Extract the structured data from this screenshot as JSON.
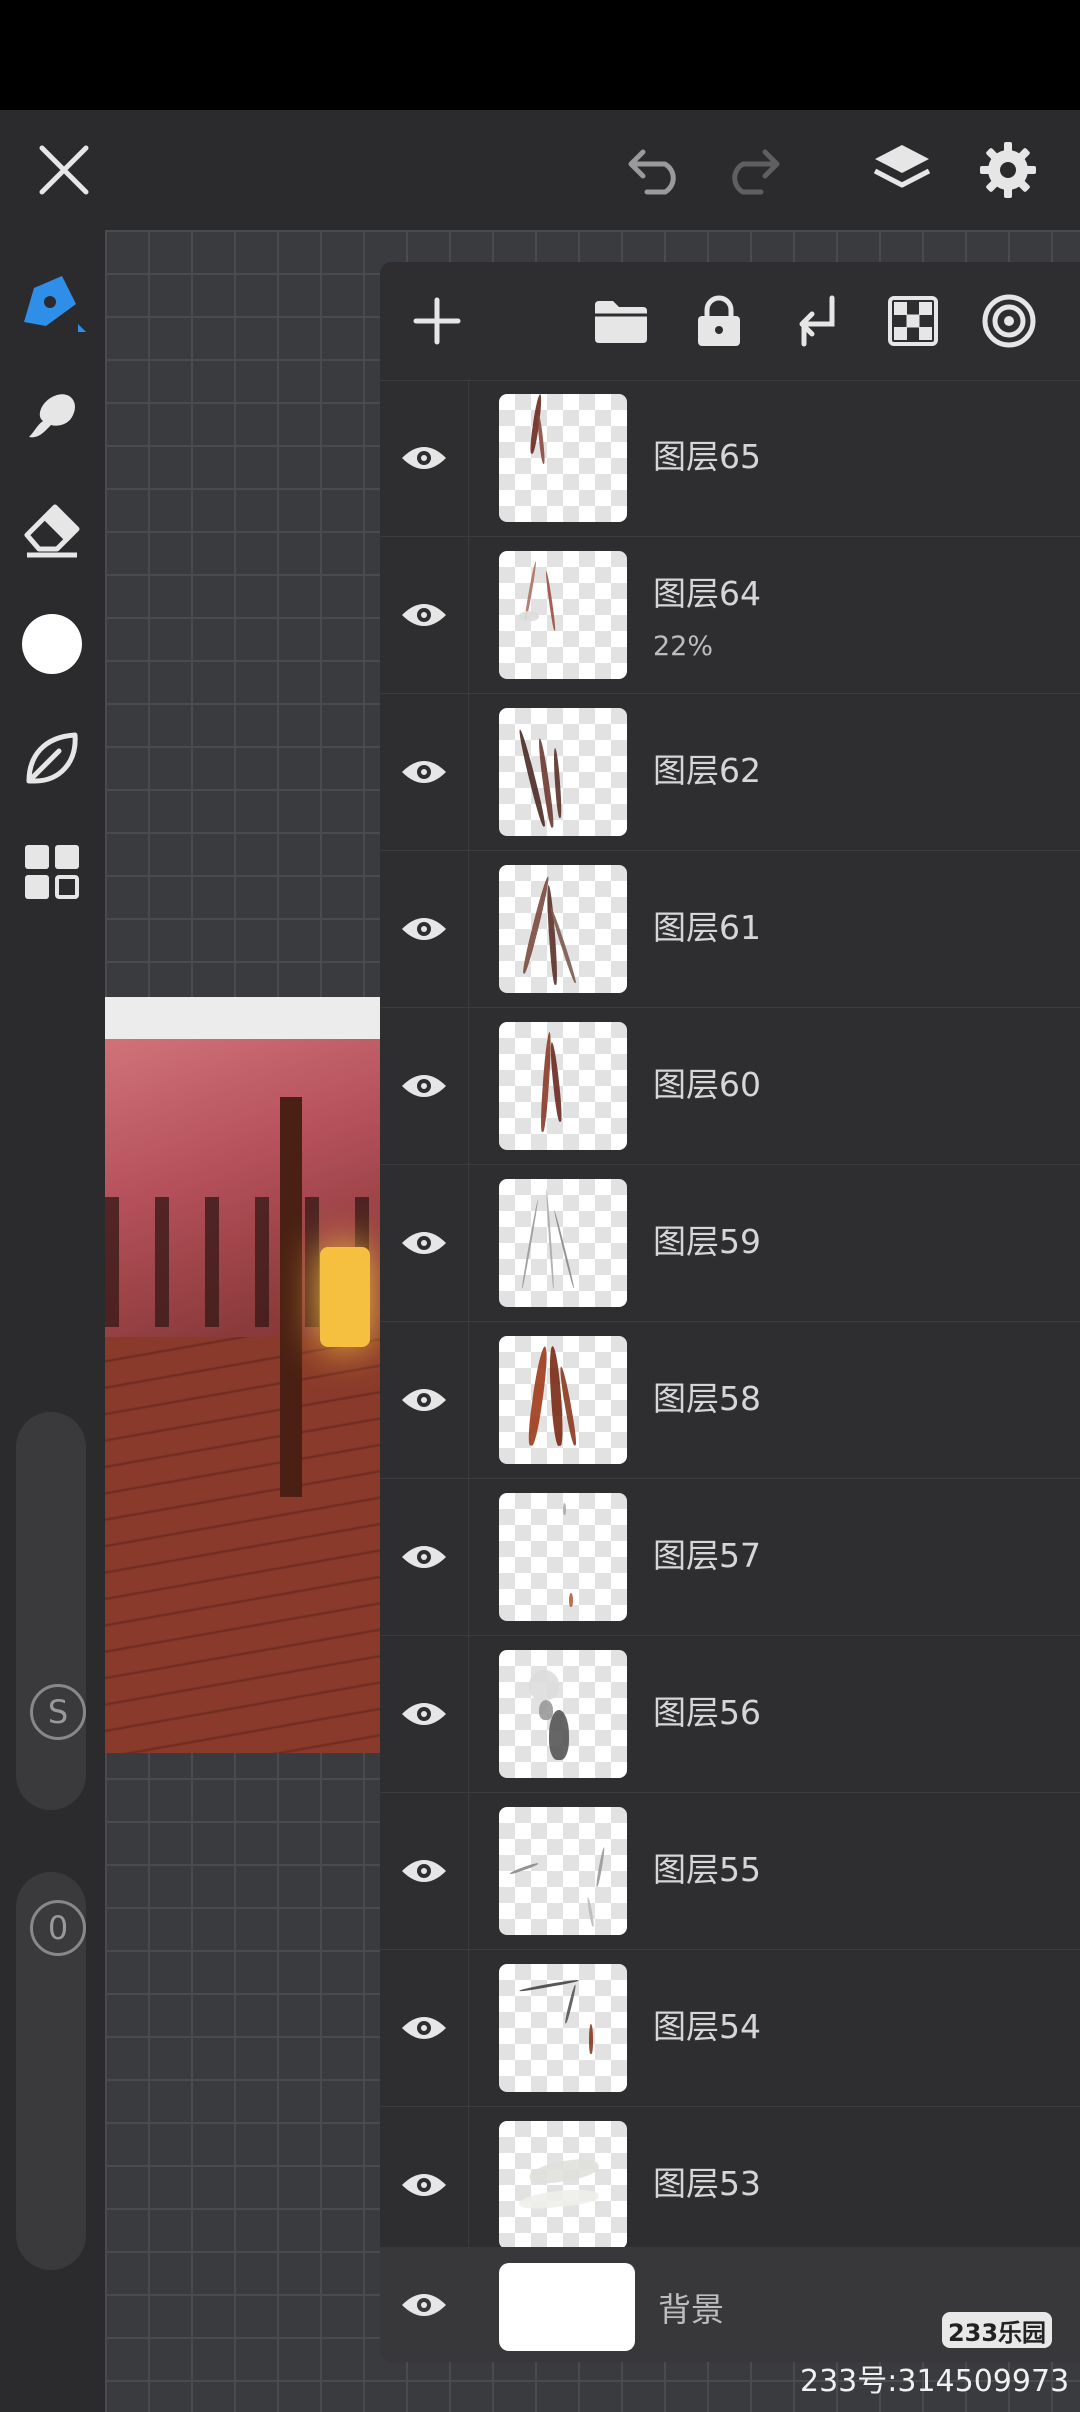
{
  "layers": [
    {
      "name": "图层65",
      "opacity": ""
    },
    {
      "name": "图层64",
      "opacity": "22%"
    },
    {
      "name": "图层62",
      "opacity": ""
    },
    {
      "name": "图层61",
      "opacity": ""
    },
    {
      "name": "图层60",
      "opacity": ""
    },
    {
      "name": "图层59",
      "opacity": ""
    },
    {
      "name": "图层58",
      "opacity": ""
    },
    {
      "name": "图层57",
      "opacity": ""
    },
    {
      "name": "图层56",
      "opacity": ""
    },
    {
      "name": "图层55",
      "opacity": ""
    },
    {
      "name": "图层54",
      "opacity": ""
    },
    {
      "name": "图层53",
      "opacity": ""
    }
  ],
  "background_layer": {
    "name": "背景"
  },
  "sliders": {
    "size_label": "S",
    "opacity_label": "0"
  },
  "watermark": {
    "logo": "233乐园",
    "id_text": "233号:314509973"
  },
  "colors": {
    "accent": "#2f8fe8",
    "panel": "#2e2e31",
    "current_color": "#ffffff"
  },
  "icons": {
    "top_bar": [
      "close-icon",
      "undo-icon",
      "redo-icon",
      "layers-icon",
      "settings-gear-icon"
    ],
    "left_tools": [
      "brush-icon",
      "smudge-icon",
      "eraser-icon",
      "color-swatch",
      "leaf-icon",
      "grid-icon"
    ],
    "panel_tools": [
      "add-layer-icon",
      "folder-icon",
      "lock-icon",
      "merge-down-icon",
      "checker-icon",
      "target-icon"
    ]
  }
}
